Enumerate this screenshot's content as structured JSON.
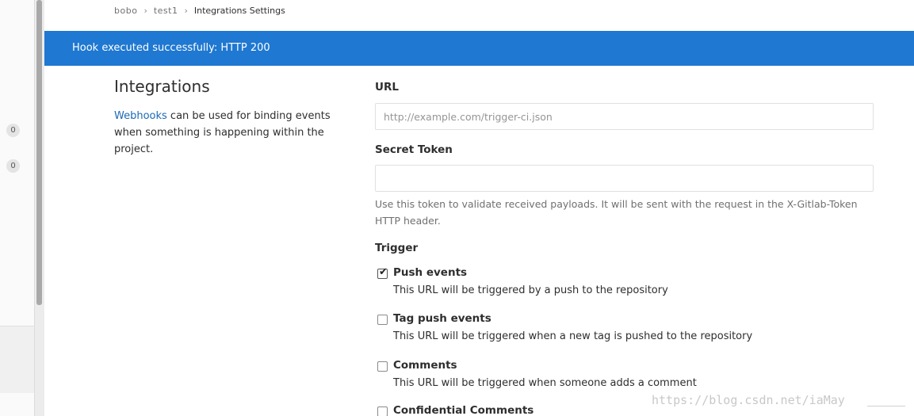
{
  "breadcrumb": {
    "items": [
      "bobo",
      "test1",
      "Integrations Settings"
    ]
  },
  "sidebar": {
    "badges": [
      "0",
      "0"
    ]
  },
  "flash": {
    "message": "Hook executed successfully: HTTP 200",
    "color": "#1f78d1"
  },
  "intro": {
    "title": "Integrations",
    "link_text": "Webhooks",
    "text": " can be used for binding events when something is happening within the project."
  },
  "form": {
    "url_label": "URL",
    "url_placeholder": "http://example.com/trigger-ci.json",
    "url_value": "",
    "token_label": "Secret Token",
    "token_value": "",
    "token_help": "Use this token to validate received payloads. It will be sent with the request in the X-Gitlab-Token HTTP header.",
    "trigger_label": "Trigger",
    "triggers": [
      {
        "name": "Push events",
        "desc": "This URL will be triggered by a push to the repository",
        "checked": true
      },
      {
        "name": "Tag push events",
        "desc": "This URL will be triggered when a new tag is pushed to the repository",
        "checked": false
      },
      {
        "name": "Comments",
        "desc": "This URL will be triggered when someone adds a comment",
        "checked": false
      },
      {
        "name": "Confidential Comments",
        "desc": "",
        "checked": false
      }
    ]
  },
  "watermark": {
    "text": "https://blog.csdn.net/iaMay"
  }
}
